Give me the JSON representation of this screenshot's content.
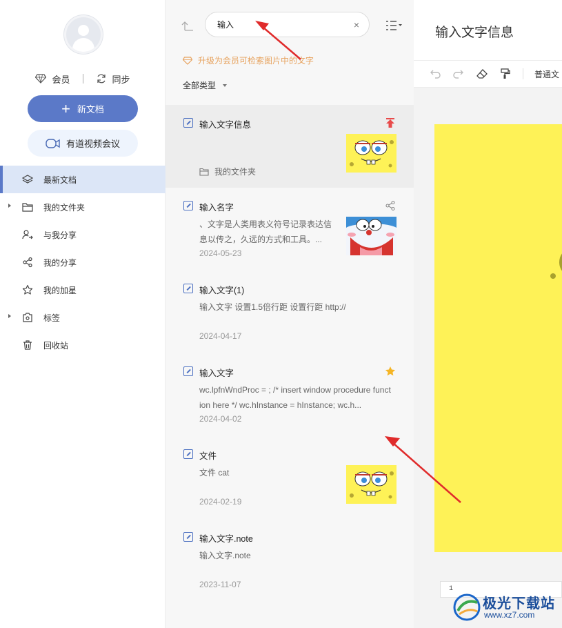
{
  "sidebar": {
    "vip_label": "会员",
    "sync_label": "同步",
    "new_doc_label": "新文档",
    "meeting_label": "有道视频会议",
    "nav": [
      {
        "label": "最新文档",
        "icon": "layers-icon"
      },
      {
        "label": "我的文件夹",
        "icon": "folder-icon"
      },
      {
        "label": "与我分享",
        "icon": "shared-user-icon"
      },
      {
        "label": "我的分享",
        "icon": "share-icon"
      },
      {
        "label": "我的加星",
        "icon": "star-icon"
      },
      {
        "label": "标签",
        "icon": "tag-icon"
      },
      {
        "label": "回收站",
        "icon": "trash-icon"
      }
    ]
  },
  "search": {
    "value": "输入",
    "clear": "×"
  },
  "upgrade_tip": "升级为会员可检索图片中的文字",
  "type_filter": "全部类型",
  "docs": [
    {
      "title": "输入文字信息",
      "folder": "我的文件夹",
      "badge": "pin-icon",
      "thumb": "spongebob"
    },
    {
      "title": "输入名字",
      "snippet": "、文字是人类用表义符号记录表达信息以传之，久远的方式和工具。...",
      "date": "2024-05-23",
      "badge": "share-icon",
      "thumb": "doraemon"
    },
    {
      "title": "输入文字(1)",
      "snippet": "输入文字 设置1.5倍行距 设置行距 http://",
      "date": "2024-04-17"
    },
    {
      "title": "输入文字",
      "snippet": "wc.lpfnWndProc = ; /* insert window procedure function here */ wc.hInstance = hInstance; wc.h...",
      "date": "2024-04-02",
      "badge": "star-icon"
    },
    {
      "title": "文件",
      "snippet": "文件 cat",
      "date": "2024-02-19",
      "thumb": "spongebob"
    },
    {
      "title": "输入文字.note",
      "snippet": "输入文字.note",
      "date": "2023-11-07"
    }
  ],
  "editor": {
    "title": "输入文字信息",
    "style_select": "普通文",
    "page_number": "1"
  },
  "watermark": {
    "name": "极光下载站",
    "url": "www.xz7.com"
  },
  "colors": {
    "accent": "#5b79c8",
    "upgrade": "#e7a25d",
    "pin": "#e84a4a",
    "star": "#f5b525",
    "canvas": "#fef257",
    "annotation": "#e02b2b"
  }
}
